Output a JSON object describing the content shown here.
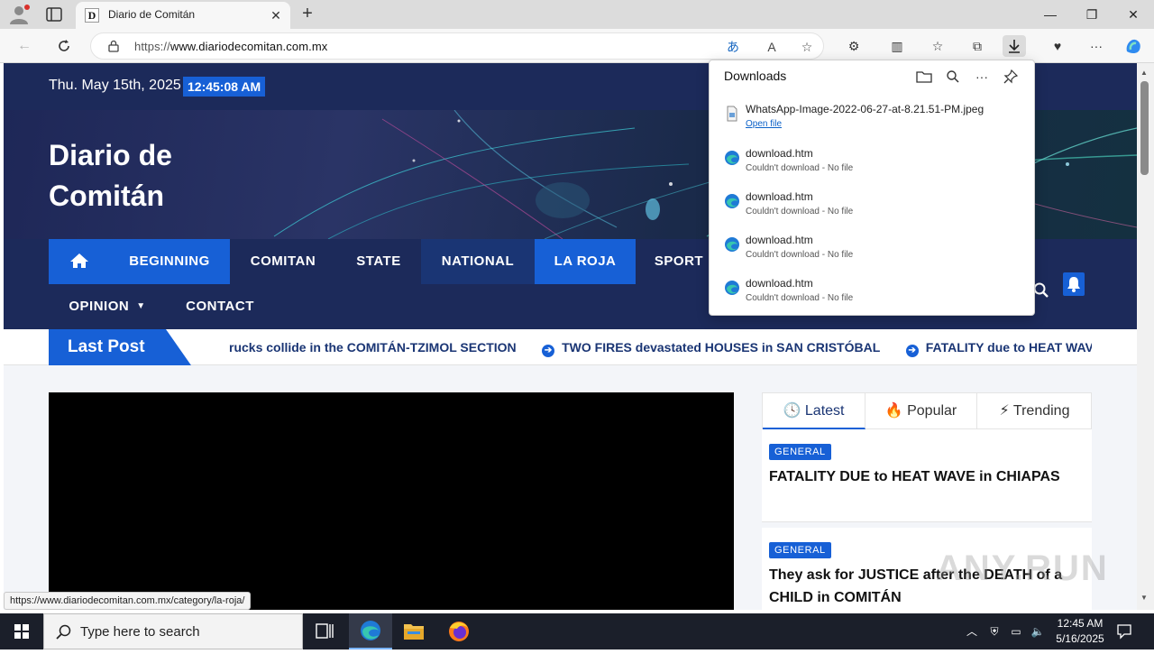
{
  "browser": {
    "tab_title": "Diario de Comitán",
    "tab_favicon_letter": "D",
    "url_host_prefix": "https://",
    "url_host": "www.diariodecomitan.com.mx",
    "status_url": "https://www.diariodecomitan.com.mx/category/la-roja/"
  },
  "downloads": {
    "title": "Downloads",
    "items": [
      {
        "name": "WhatsApp-Image-2022-06-27-at-8.21.51-PM.jpeg",
        "status": "Open file",
        "icon": "file-icon"
      },
      {
        "name": "download.htm",
        "status": "Couldn't download - No file",
        "icon": "edge-icon"
      },
      {
        "name": "download.htm",
        "status": "Couldn't download - No file",
        "icon": "edge-icon"
      },
      {
        "name": "download.htm",
        "status": "Couldn't download - No file",
        "icon": "edge-icon"
      },
      {
        "name": "download.htm",
        "status": "Couldn't download - No file",
        "icon": "edge-icon"
      }
    ]
  },
  "site": {
    "date": "Thu. May 15th, 2025",
    "time": "12:45:08 AM",
    "title_line1": "Diario de",
    "title_line2": "Comitán",
    "menu": {
      "beginning": "BEGINNING",
      "comitan": "COMITAN",
      "state": "STATE",
      "national": "NATIONAL",
      "la_roja": "LA ROJA",
      "sport": "SPORT",
      "opinion": "OPINION",
      "contact": "CONTACT"
    },
    "ticker_label": "Last Post",
    "ticker": [
      "rucks collide in the COMITÁN-TZIMOL SECTION",
      "TWO FIRES devastated HOUSES in SAN CRISTÓBAL",
      "FATALITY due to HEAT WAVE in CHIAPAS"
    ],
    "widget_tabs": {
      "latest": "Latest",
      "popular": "Popular",
      "trending": "Trending"
    },
    "posts": [
      {
        "category": "GENERAL",
        "title": "FATALITY DUE to HEAT WAVE in CHIAPAS"
      },
      {
        "category": "GENERAL",
        "title": "They ask for JUSTICE after the DEATH of a CHILD in COMITÁN"
      }
    ]
  },
  "watermark": "ANY.RUN",
  "taskbar": {
    "search_placeholder": "Type here to search",
    "time": "12:45 AM",
    "date": "5/16/2025"
  },
  "colors": {
    "navy": "#1c2a5a",
    "accent_blue": "#1760d6",
    "menu_dark": "#1a3574"
  }
}
